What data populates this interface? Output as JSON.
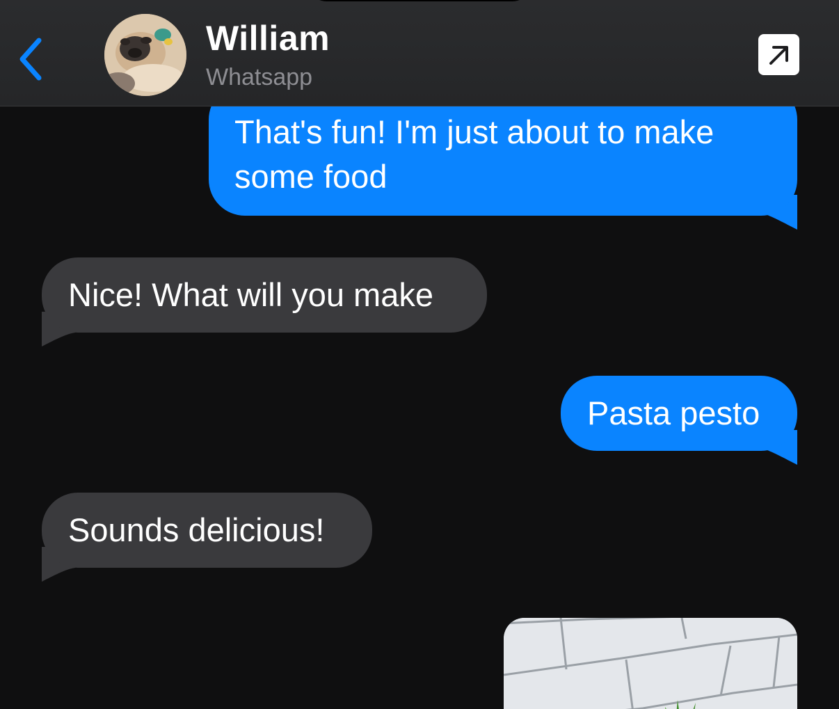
{
  "header": {
    "contact_name": "William",
    "contact_subtitle": "Whatsapp",
    "back_icon": "chevron-left-icon",
    "open_icon": "arrow-up-right-icon"
  },
  "messages": [
    {
      "direction": "outgoing",
      "text_lines": [
        "That's fun! I'm just about to make",
        "some food"
      ]
    },
    {
      "direction": "incoming",
      "text": "Nice! What will you make"
    },
    {
      "direction": "outgoing",
      "text": "Pasta pesto"
    },
    {
      "direction": "incoming",
      "text": "Sounds delicious!"
    },
    {
      "direction": "outgoing",
      "type": "photo"
    }
  ],
  "colors": {
    "outgoing_bubble": "#0a84ff",
    "incoming_bubble": "#3a3a3d",
    "background": "#0f0f10",
    "accent": "#0a84ff"
  }
}
